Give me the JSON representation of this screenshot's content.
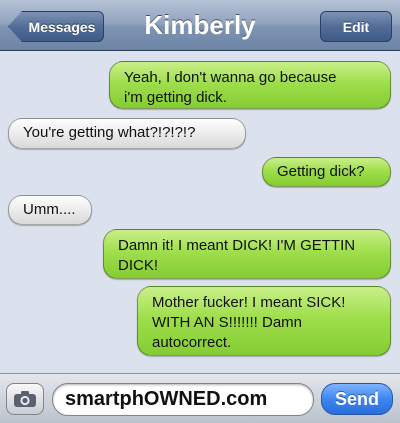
{
  "navbar": {
    "back_label": "Messages",
    "title": "Kimberly",
    "edit_label": "Edit"
  },
  "messages": [
    {
      "from": "me",
      "line1": "Yeah, I don't wanna go because",
      "line2": "i'm getting dick."
    },
    {
      "from": "them",
      "line1": "You're getting what?!?!?!?"
    },
    {
      "from": "me",
      "line1": "Getting dick?"
    },
    {
      "from": "them",
      "line1": "Umm...."
    },
    {
      "from": "me",
      "line1": "Damn it! I meant DICK! I'M GETTIN",
      "line2": "DICK!"
    },
    {
      "from": "me",
      "line1": "Mother fucker! I meant SICK!",
      "line2": "WITH AN S!!!!!!! Damn",
      "line3": "autocorrect."
    }
  ],
  "composer": {
    "input_value": "smartphOWNED.com",
    "send_label": "Send",
    "camera_icon": "camera-icon"
  },
  "colors": {
    "sent_bubble": "#9fde4c",
    "received_bubble": "#eaeaea",
    "send_button": "#3d86f2",
    "navbar": "#8fa2bd"
  }
}
